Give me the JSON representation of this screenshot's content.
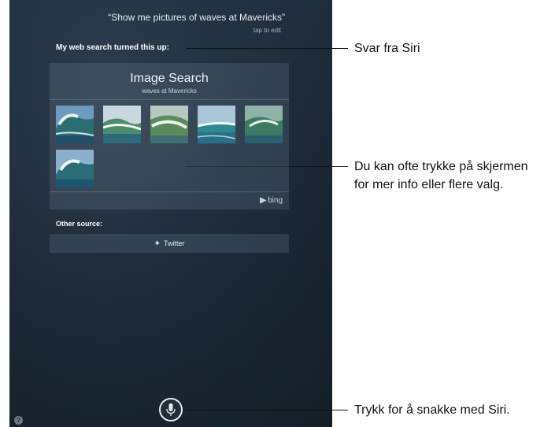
{
  "siri": {
    "utterance": "“Show me pictures of waves at Mavericks”",
    "tap_to_edit": "tap to edit",
    "intro": "My web search turned this up:",
    "card": {
      "title": "Image Search",
      "subtitle": "waves at Mavericks",
      "provider": "bing",
      "image_count": 6
    },
    "other_source_label": "Other source:",
    "twitter_label": "Twitter"
  },
  "callouts": {
    "siri_reply": "Svar fra Siri",
    "more_info": "Du kan ofte trykke på skjermen for mer info eller flere valg.",
    "tap_to_talk": "Trykk for å snakke med Siri."
  },
  "colors": {
    "background": "#1a2633",
    "card": "#5a6b7d",
    "wave_teal": "#2f7f7a",
    "sky_blue": "#7fa7c6"
  }
}
